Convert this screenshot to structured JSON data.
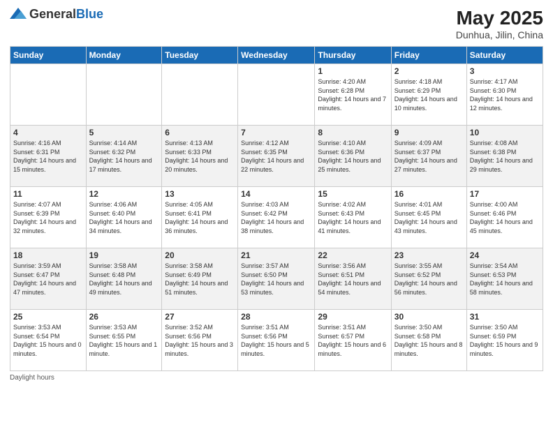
{
  "logo": {
    "general": "General",
    "blue": "Blue"
  },
  "title": "May 2025",
  "location": "Dunhua, Jilin, China",
  "days_of_week": [
    "Sunday",
    "Monday",
    "Tuesday",
    "Wednesday",
    "Thursday",
    "Friday",
    "Saturday"
  ],
  "footer_note": "Daylight hours",
  "weeks": [
    [
      {
        "day": "",
        "info": ""
      },
      {
        "day": "",
        "info": ""
      },
      {
        "day": "",
        "info": ""
      },
      {
        "day": "",
        "info": ""
      },
      {
        "day": "1",
        "info": "Sunrise: 4:20 AM\nSunset: 6:28 PM\nDaylight: 14 hours and 7 minutes."
      },
      {
        "day": "2",
        "info": "Sunrise: 4:18 AM\nSunset: 6:29 PM\nDaylight: 14 hours and 10 minutes."
      },
      {
        "day": "3",
        "info": "Sunrise: 4:17 AM\nSunset: 6:30 PM\nDaylight: 14 hours and 12 minutes."
      }
    ],
    [
      {
        "day": "4",
        "info": "Sunrise: 4:16 AM\nSunset: 6:31 PM\nDaylight: 14 hours and 15 minutes."
      },
      {
        "day": "5",
        "info": "Sunrise: 4:14 AM\nSunset: 6:32 PM\nDaylight: 14 hours and 17 minutes."
      },
      {
        "day": "6",
        "info": "Sunrise: 4:13 AM\nSunset: 6:33 PM\nDaylight: 14 hours and 20 minutes."
      },
      {
        "day": "7",
        "info": "Sunrise: 4:12 AM\nSunset: 6:35 PM\nDaylight: 14 hours and 22 minutes."
      },
      {
        "day": "8",
        "info": "Sunrise: 4:10 AM\nSunset: 6:36 PM\nDaylight: 14 hours and 25 minutes."
      },
      {
        "day": "9",
        "info": "Sunrise: 4:09 AM\nSunset: 6:37 PM\nDaylight: 14 hours and 27 minutes."
      },
      {
        "day": "10",
        "info": "Sunrise: 4:08 AM\nSunset: 6:38 PM\nDaylight: 14 hours and 29 minutes."
      }
    ],
    [
      {
        "day": "11",
        "info": "Sunrise: 4:07 AM\nSunset: 6:39 PM\nDaylight: 14 hours and 32 minutes."
      },
      {
        "day": "12",
        "info": "Sunrise: 4:06 AM\nSunset: 6:40 PM\nDaylight: 14 hours and 34 minutes."
      },
      {
        "day": "13",
        "info": "Sunrise: 4:05 AM\nSunset: 6:41 PM\nDaylight: 14 hours and 36 minutes."
      },
      {
        "day": "14",
        "info": "Sunrise: 4:03 AM\nSunset: 6:42 PM\nDaylight: 14 hours and 38 minutes."
      },
      {
        "day": "15",
        "info": "Sunrise: 4:02 AM\nSunset: 6:43 PM\nDaylight: 14 hours and 41 minutes."
      },
      {
        "day": "16",
        "info": "Sunrise: 4:01 AM\nSunset: 6:45 PM\nDaylight: 14 hours and 43 minutes."
      },
      {
        "day": "17",
        "info": "Sunrise: 4:00 AM\nSunset: 6:46 PM\nDaylight: 14 hours and 45 minutes."
      }
    ],
    [
      {
        "day": "18",
        "info": "Sunrise: 3:59 AM\nSunset: 6:47 PM\nDaylight: 14 hours and 47 minutes."
      },
      {
        "day": "19",
        "info": "Sunrise: 3:58 AM\nSunset: 6:48 PM\nDaylight: 14 hours and 49 minutes."
      },
      {
        "day": "20",
        "info": "Sunrise: 3:58 AM\nSunset: 6:49 PM\nDaylight: 14 hours and 51 minutes."
      },
      {
        "day": "21",
        "info": "Sunrise: 3:57 AM\nSunset: 6:50 PM\nDaylight: 14 hours and 53 minutes."
      },
      {
        "day": "22",
        "info": "Sunrise: 3:56 AM\nSunset: 6:51 PM\nDaylight: 14 hours and 54 minutes."
      },
      {
        "day": "23",
        "info": "Sunrise: 3:55 AM\nSunset: 6:52 PM\nDaylight: 14 hours and 56 minutes."
      },
      {
        "day": "24",
        "info": "Sunrise: 3:54 AM\nSunset: 6:53 PM\nDaylight: 14 hours and 58 minutes."
      }
    ],
    [
      {
        "day": "25",
        "info": "Sunrise: 3:53 AM\nSunset: 6:54 PM\nDaylight: 15 hours and 0 minutes."
      },
      {
        "day": "26",
        "info": "Sunrise: 3:53 AM\nSunset: 6:55 PM\nDaylight: 15 hours and 1 minute."
      },
      {
        "day": "27",
        "info": "Sunrise: 3:52 AM\nSunset: 6:56 PM\nDaylight: 15 hours and 3 minutes."
      },
      {
        "day": "28",
        "info": "Sunrise: 3:51 AM\nSunset: 6:56 PM\nDaylight: 15 hours and 5 minutes."
      },
      {
        "day": "29",
        "info": "Sunrise: 3:51 AM\nSunset: 6:57 PM\nDaylight: 15 hours and 6 minutes."
      },
      {
        "day": "30",
        "info": "Sunrise: 3:50 AM\nSunset: 6:58 PM\nDaylight: 15 hours and 8 minutes."
      },
      {
        "day": "31",
        "info": "Sunrise: 3:50 AM\nSunset: 6:59 PM\nDaylight: 15 hours and 9 minutes."
      }
    ]
  ]
}
